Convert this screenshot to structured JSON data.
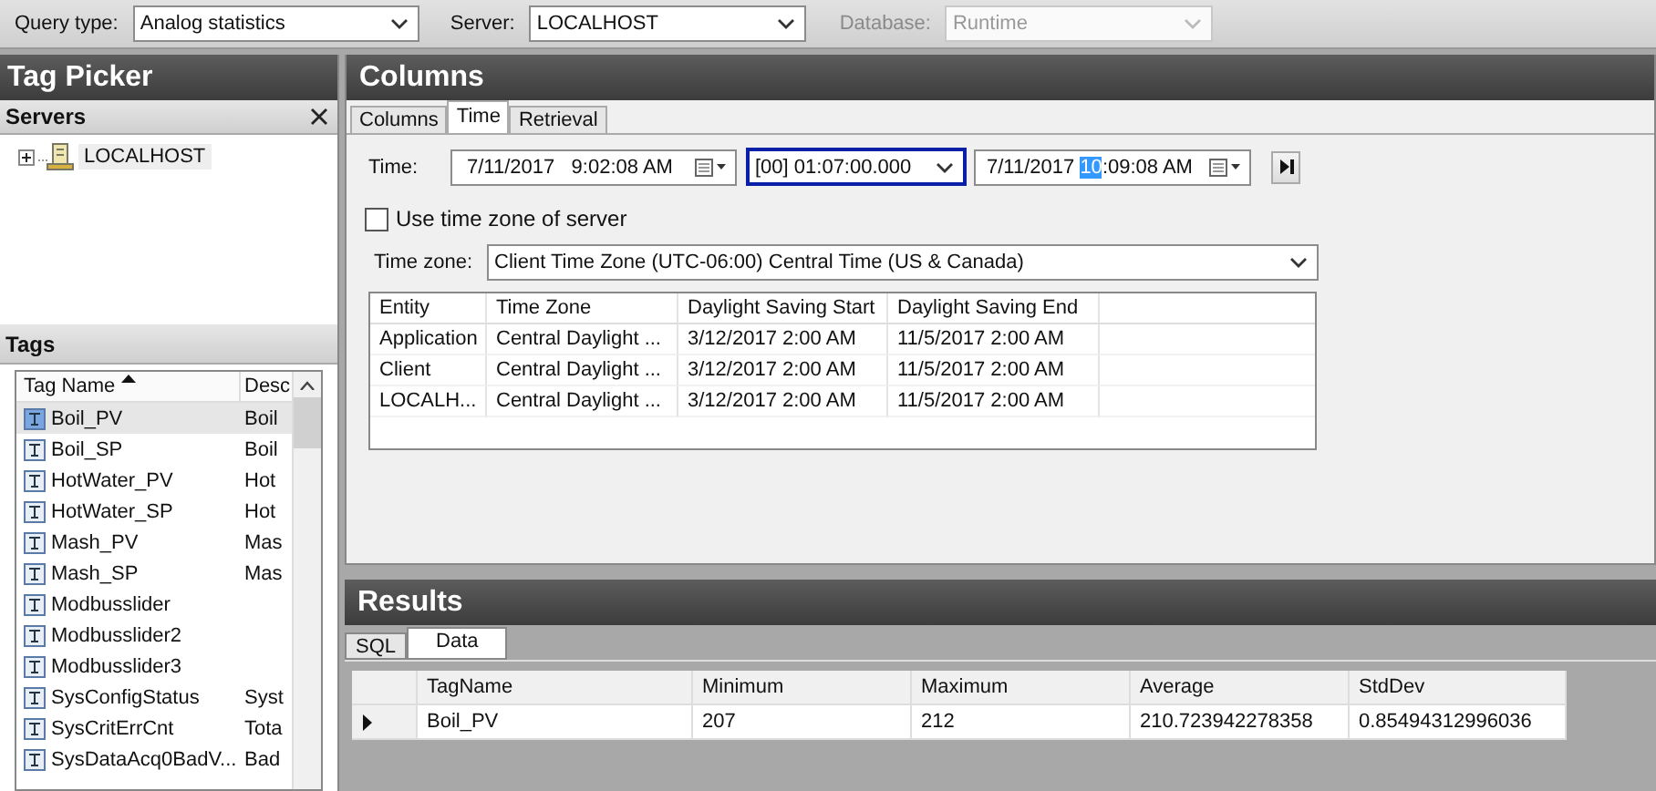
{
  "toolbar": {
    "fields": [
      {
        "label": "Query type:",
        "value": "Analog statistics",
        "disabled": false
      },
      {
        "label": "Server:",
        "value": "LOCALHOST",
        "disabled": false
      },
      {
        "label": "Database:",
        "value": "Runtime",
        "disabled": true
      }
    ]
  },
  "tag_picker": {
    "title": "Tag Picker",
    "servers": {
      "title": "Servers",
      "items": [
        {
          "label": "LOCALHOST",
          "expanded": false
        }
      ]
    },
    "tags": {
      "title": "Tags",
      "columns": [
        {
          "label": "Tag Name",
          "sorted": true
        },
        {
          "label": "Desc",
          "sorted": false
        }
      ],
      "rows": [
        {
          "name": "Boil_PV",
          "desc": "Boil",
          "selected": true
        },
        {
          "name": "Boil_SP",
          "desc": "Boil",
          "selected": false
        },
        {
          "name": "HotWater_PV",
          "desc": "Hot",
          "selected": false
        },
        {
          "name": "HotWater_SP",
          "desc": "Hot",
          "selected": false
        },
        {
          "name": "Mash_PV",
          "desc": "Mas",
          "selected": false
        },
        {
          "name": "Mash_SP",
          "desc": "Mas",
          "selected": false
        },
        {
          "name": "Modbusslider",
          "desc": "",
          "selected": false
        },
        {
          "name": "Modbusslider2",
          "desc": "",
          "selected": false
        },
        {
          "name": "Modbusslider3",
          "desc": "",
          "selected": false
        },
        {
          "name": "SysConfigStatus",
          "desc": "Syst",
          "selected": false
        },
        {
          "name": "SysCritErrCnt",
          "desc": "Tota",
          "selected": false
        },
        {
          "name": "SysDataAcq0BadV...",
          "desc": "Bad",
          "selected": false
        }
      ]
    }
  },
  "columns_panel": {
    "title": "Columns",
    "tabs": [
      {
        "label": "Columns",
        "selected": false
      },
      {
        "label": "Time",
        "selected": true
      },
      {
        "label": "Retrieval",
        "selected": false
      }
    ],
    "time": {
      "label": "Time:",
      "start": "7/11/2017   9:02:08 AM",
      "duration": {
        "value": "[00] 01:07:00.000",
        "focused": true
      },
      "end": {
        "prefix": "7/11/2017 ",
        "selected_segment": "10",
        "suffix": ":09:08 AM"
      }
    },
    "use_server_time_zone": {
      "label": "Use time zone of server",
      "checked": false
    },
    "time_zone": {
      "label": "Time zone:",
      "value": "Client Time Zone (UTC-06:00) Central Time (US & Canada)"
    },
    "zone_table": {
      "columns": [
        "Entity",
        "Time Zone",
        "Daylight Saving Start",
        "Daylight Saving End"
      ],
      "rows": [
        [
          "Application",
          "Central Daylight ...",
          "3/12/2017 2:00 AM",
          "11/5/2017 2:00 AM"
        ],
        [
          "Client",
          "Central Daylight ...",
          "3/12/2017 2:00 AM",
          "11/5/2017 2:00 AM"
        ],
        [
          "LOCALH...",
          "Central Daylight ...",
          "3/12/2017 2:00 AM",
          "11/5/2017 2:00 AM"
        ]
      ]
    }
  },
  "results": {
    "title": "Results",
    "tabs": [
      {
        "label": "SQL",
        "selected": false
      },
      {
        "label": "Data",
        "selected": true
      }
    ],
    "grid": {
      "columns": [
        "TagName",
        "Minimum",
        "Maximum",
        "Average",
        "StdDev"
      ],
      "rows": [
        {
          "current": true,
          "cells": [
            "Boil_PV",
            "207",
            "212",
            "210.723942278358",
            "0.85494312996036"
          ]
        }
      ]
    }
  }
}
